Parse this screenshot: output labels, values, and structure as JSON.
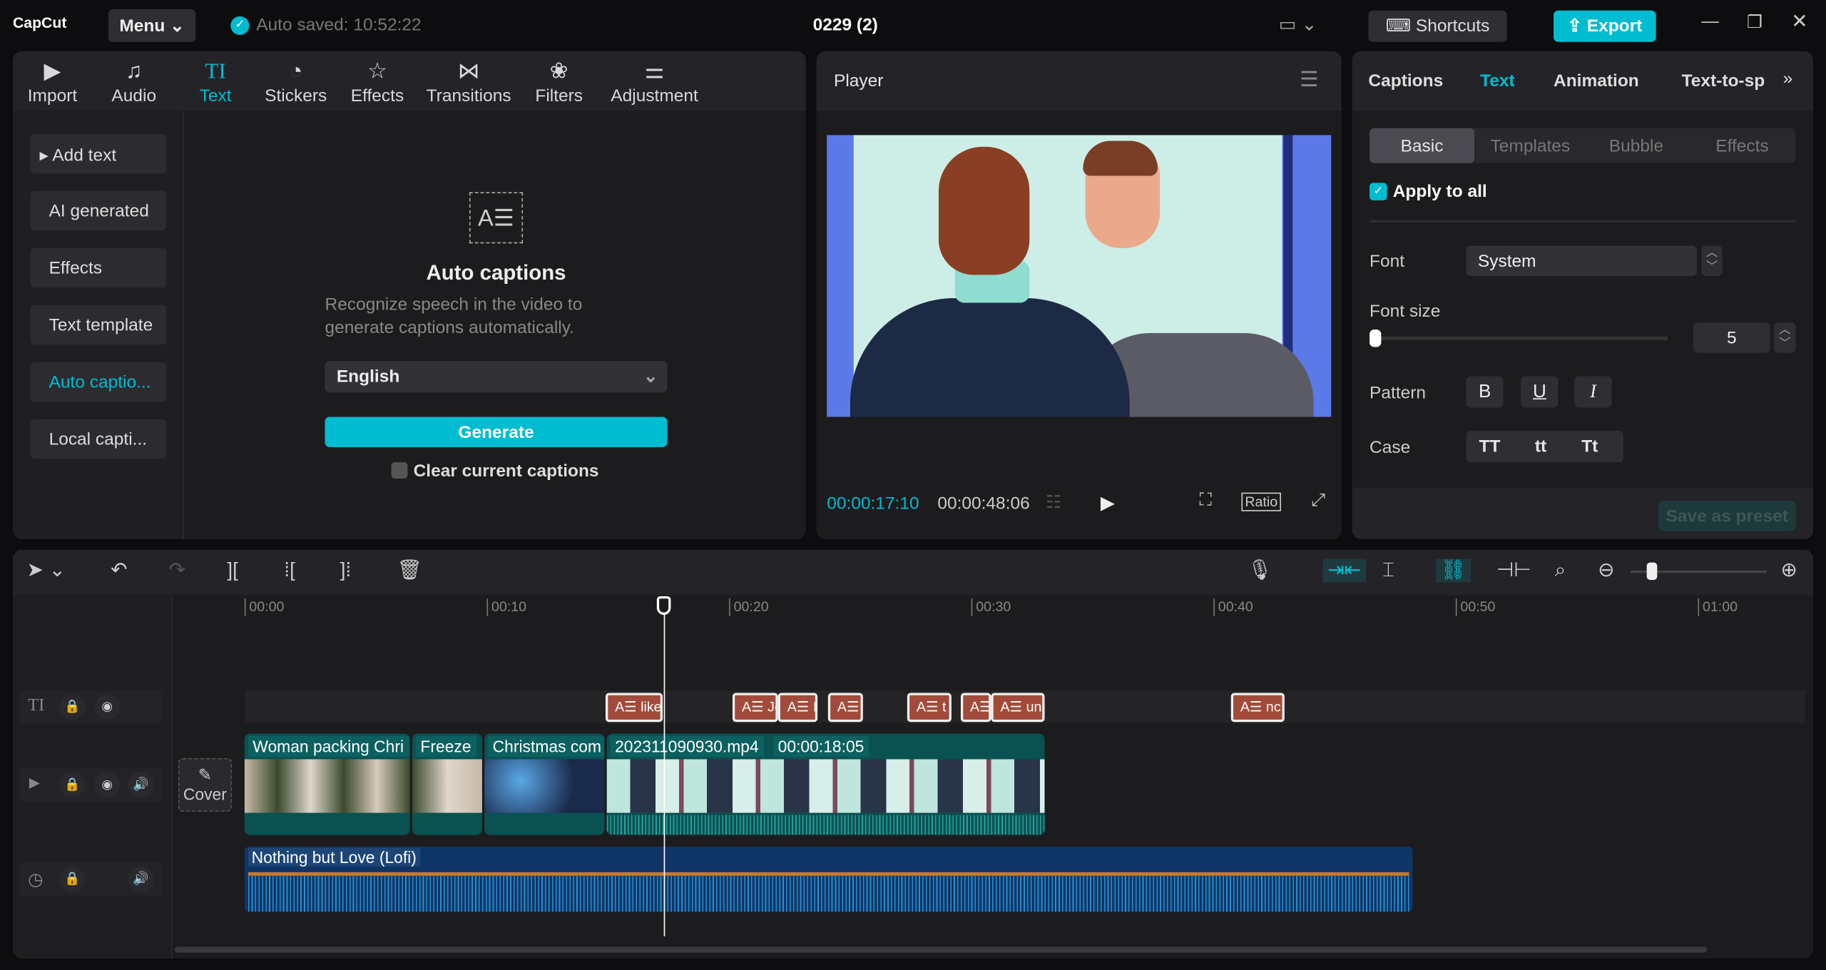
{
  "app": {
    "logo": "CapCut",
    "menu": "Menu",
    "autosave": "Auto saved: 10:52:22",
    "project_title": "0229 (2)",
    "shortcuts": "Shortcuts",
    "export": "Export"
  },
  "colors": {
    "accent": "#00bcd0",
    "caption_clip": "#a24b3a",
    "video_clip": "#0a5252",
    "audio_clip": "#0f3566"
  },
  "toolbar": [
    {
      "label": "Import",
      "icon": "import-icon"
    },
    {
      "label": "Audio",
      "icon": "audio-icon"
    },
    {
      "label": "Text",
      "icon": "text-icon",
      "active": true
    },
    {
      "label": "Stickers",
      "icon": "sticker-icon"
    },
    {
      "label": "Effects",
      "icon": "effects-icon"
    },
    {
      "label": "Transitions",
      "icon": "transitions-icon"
    },
    {
      "label": "Filters",
      "icon": "filters-icon"
    },
    {
      "label": "Adjustment",
      "icon": "adjustment-icon"
    }
  ],
  "sidebar": [
    "Add text",
    "AI generated",
    "Effects",
    "Text template",
    "Auto captio...",
    "Local capti..."
  ],
  "auto_captions": {
    "title": "Auto captions",
    "desc": "Recognize speech in the video to generate captions automatically.",
    "language": "English",
    "generate": "Generate",
    "clear": "Clear current captions"
  },
  "player": {
    "title": "Player",
    "current": "00:00:17:10",
    "total": "00:00:48:06",
    "ratio": "Ratio"
  },
  "right": {
    "tabs": [
      "Captions",
      "Text",
      "Animation",
      "Text-to-sp"
    ],
    "subtabs": [
      "Basic",
      "Templates",
      "Bubble",
      "Effects"
    ],
    "apply_all": "Apply to all",
    "font_label": "Font",
    "font_value": "System",
    "size_label": "Font size",
    "size_value": "5",
    "pattern_label": "Pattern",
    "pattern": [
      "B",
      "U",
      "I"
    ],
    "case_label": "Case",
    "case": [
      "TT",
      "tt",
      "Tt"
    ],
    "save_preset": "Save as preset"
  },
  "timeline": {
    "ticks": [
      "00:00",
      "00:10",
      "00:20",
      "00:30",
      "00:40",
      "00:50",
      "01:00"
    ],
    "playhead_seconds": 17.3,
    "captions": [
      "like",
      "Je",
      "I",
      "",
      "t",
      "",
      "un",
      "nc"
    ],
    "video_clips": [
      "Woman packing Chri",
      "Freeze",
      "Christmas com",
      "202311090930.mp4"
    ],
    "video_duration": "00:00:18:05",
    "audio": "Nothing but Love (Lofi)",
    "cover": "Cover"
  }
}
